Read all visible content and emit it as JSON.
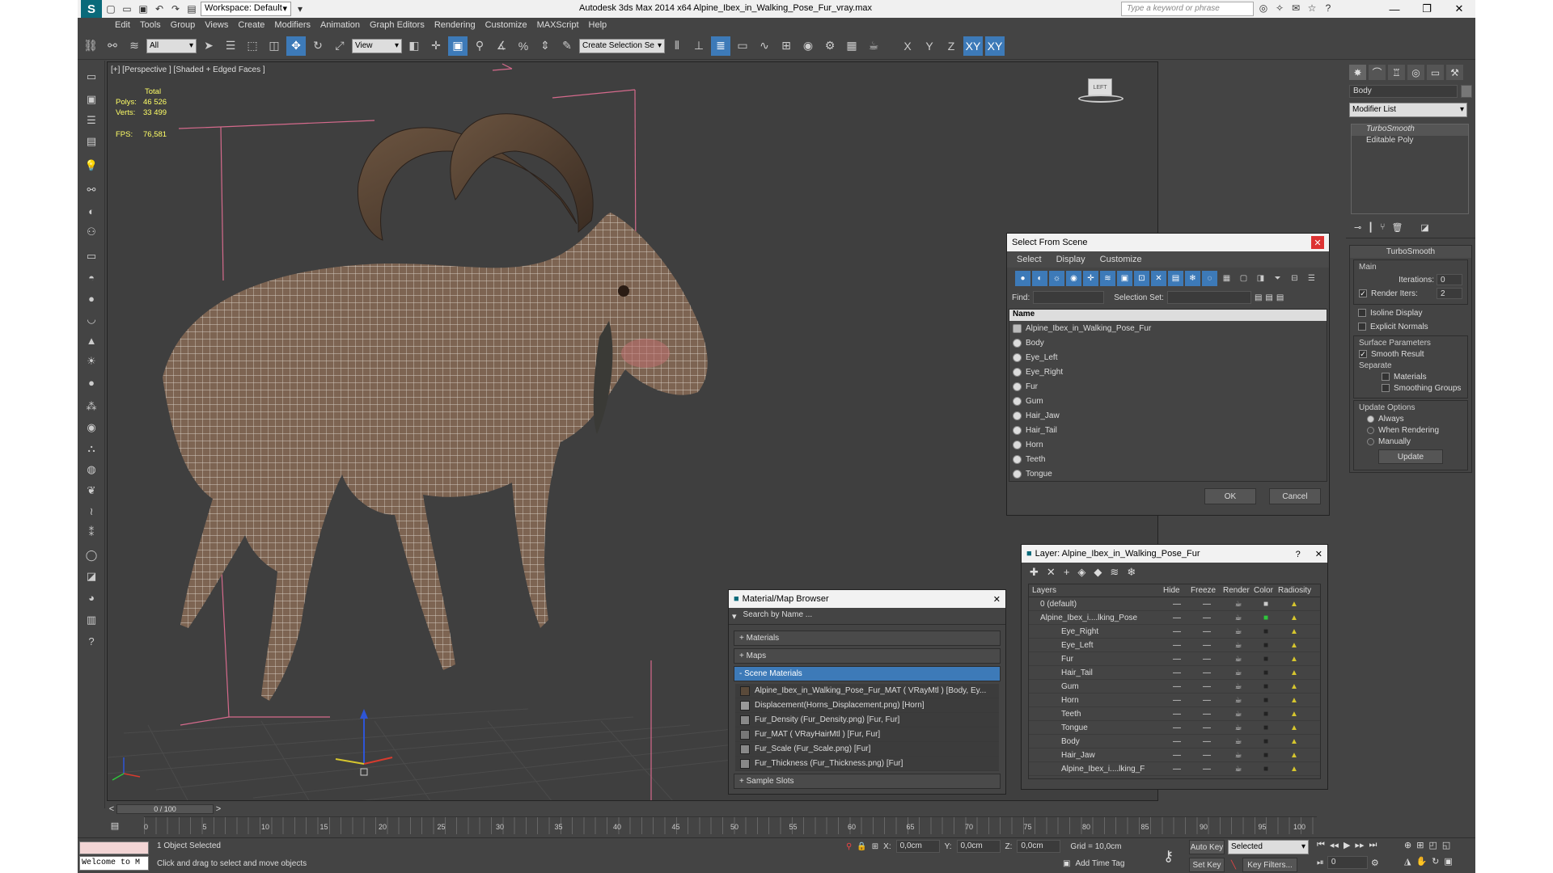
{
  "titlebar": {
    "workspace": "Workspace: Default",
    "title": "Autodesk 3ds Max  2014 x64     Alpine_Ibex_in_Walking_Pose_Fur_vray.max",
    "search_placeholder": "Type a keyword or phrase"
  },
  "menu": [
    "Edit",
    "Tools",
    "Group",
    "Views",
    "Create",
    "Modifiers",
    "Animation",
    "Graph Editors",
    "Rendering",
    "Customize",
    "MAXScript",
    "Help"
  ],
  "toolbar": {
    "selection_filter": "All",
    "ref_coord": "View",
    "named_selection": "Create Selection Se",
    "axis_labels": [
      "X",
      "Y",
      "Z",
      "XY",
      "XY"
    ]
  },
  "viewport": {
    "label": "[+] [Perspective ] [Shaded + Edged Faces ]",
    "stats": {
      "total_label": "Total",
      "polys_label": "Polys:",
      "polys_value": "46 526",
      "verts_label": "Verts:",
      "verts_value": "33 499",
      "fps_label": "FPS:",
      "fps_value": "76,581"
    },
    "cube_label": "LEFT"
  },
  "command_panel": {
    "object_name": "Body",
    "modifier_list": "Modifier List",
    "stack": [
      "TurboSmooth",
      "Editable Poly"
    ],
    "rollout_title": "TurboSmooth",
    "main_label": "Main",
    "iterations_label": "Iterations:",
    "iterations_value": "0",
    "render_iters_label": "Render Iters:",
    "render_iters_value": "2",
    "isoline": "Isoline Display",
    "explicit": "Explicit Normals",
    "surface_label": "Surface Parameters",
    "smooth_result": "Smooth Result",
    "separate_label": "Separate",
    "materials": "Materials",
    "smoothing_groups": "Smoothing Groups",
    "update_options": "Update Options",
    "always": "Always",
    "when_rendering": "When Rendering",
    "manually": "Manually",
    "update_btn": "Update"
  },
  "select_dialog": {
    "title": "Select From Scene",
    "menus": [
      "Select",
      "Display",
      "Customize"
    ],
    "find_label": "Find:",
    "selset_label": "Selection Set:",
    "col_name": "Name",
    "items": [
      "Alpine_Ibex_in_Walking_Pose_Fur",
      "Body",
      "Eye_Left",
      "Eye_Right",
      "Fur",
      "Gum",
      "Hair_Jaw",
      "Hair_Tail",
      "Horn",
      "Teeth",
      "Tongue"
    ],
    "ok": "OK",
    "cancel": "Cancel"
  },
  "layer_dialog": {
    "title": "Layer: Alpine_Ibex_in_Walking_Pose_Fur",
    "cols": [
      "Layers",
      "Hide",
      "Freeze",
      "Render",
      "Color",
      "Radiosity"
    ],
    "rows": [
      "0 (default)",
      "Alpine_Ibex_i....lking_Pose",
      "Eye_Right",
      "Eye_Left",
      "Fur",
      "Hair_Tail",
      "Gum",
      "Horn",
      "Teeth",
      "Tongue",
      "Body",
      "Hair_Jaw",
      "Alpine_Ibex_i....lking_F"
    ]
  },
  "material_dialog": {
    "title": "Material/Map Browser",
    "search_placeholder": "Search by Name ...",
    "sections": [
      "+ Materials",
      "+ Maps",
      "- Scene Materials",
      "+ Sample Slots"
    ],
    "items": [
      "Alpine_Ibex_in_Walking_Pose_Fur_MAT ( VRayMtl ) [Body, Ey...",
      "Displacement(Horns_Displacement.png) [Horn]",
      "Fur_Density (Fur_Density.png) [Fur, Fur]",
      "Fur_MAT ( VRayHairMtl ) [Fur, Fur]",
      "Fur_Scale (Fur_Scale.png) [Fur]",
      "Fur_Thickness (Fur_Thickness.png) [Fur]"
    ]
  },
  "timeline": {
    "frame": "0 / 100",
    "ticks": [
      "0",
      "5",
      "10",
      "15",
      "20",
      "25",
      "30",
      "35",
      "40",
      "45",
      "50",
      "55",
      "60",
      "65",
      "70",
      "75",
      "80",
      "85",
      "90",
      "95",
      "100"
    ]
  },
  "status": {
    "maxscript": "Welcome to M",
    "selected": "1 Object Selected",
    "prompt": "Click and drag to select and move objects",
    "x_label": "X:",
    "x_value": "0,0cm",
    "y_label": "Y:",
    "y_value": "0,0cm",
    "z_label": "Z:",
    "z_value": "0,0cm",
    "grid": "Grid = 10,0cm",
    "add_time_tag": "Add Time Tag",
    "auto_key": "Auto Key",
    "auto_key_sel": "Selected",
    "set_key": "Set Key",
    "key_filters": "Key Filters...",
    "frame_field": "0"
  },
  "colors": {
    "accent": "#3d7ab8",
    "stats": "#ffff66",
    "bg": "#444444"
  }
}
